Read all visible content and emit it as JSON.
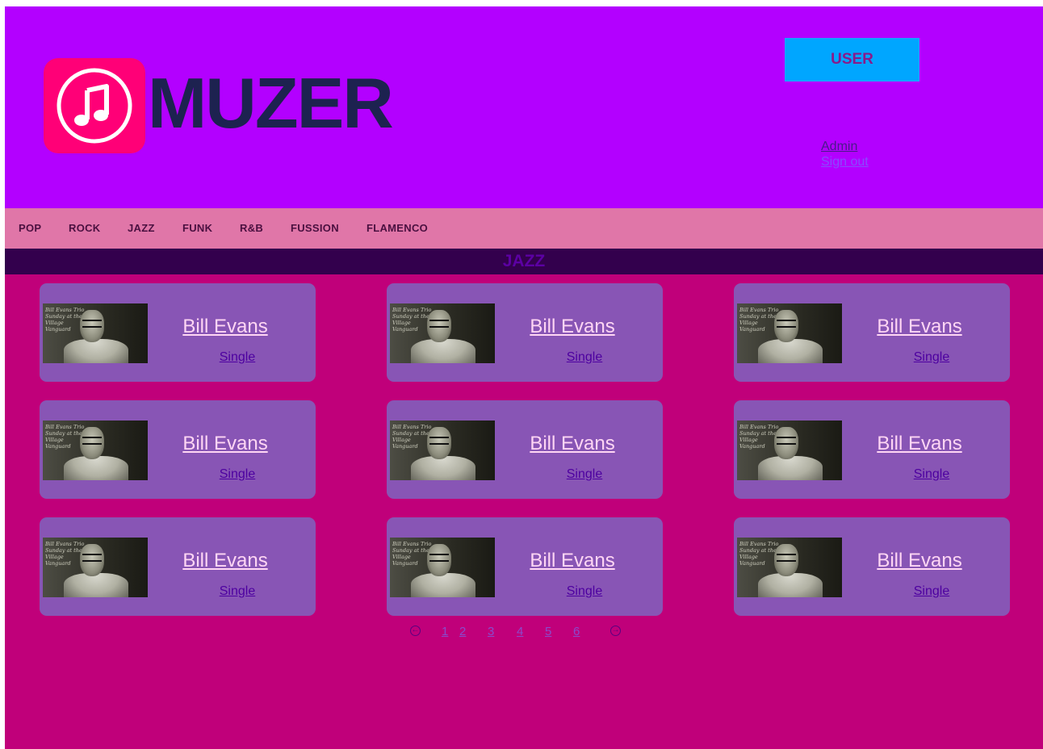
{
  "header": {
    "logo_text": "MUZER",
    "user_button": "USER",
    "admin_link": "Admin",
    "signout_link": "Sign out"
  },
  "nav": {
    "items": [
      "POP",
      "ROCK",
      "JAZZ",
      "FUNK",
      "R&B",
      "FUSSION",
      "FLAMENCO"
    ]
  },
  "section": {
    "title": "JAZZ"
  },
  "cards": [
    {
      "title": "Bill Evans",
      "subtitle": "Single",
      "cover_text": "Bill Evans Trio Sunday at the Village Vanguard"
    },
    {
      "title": "Bill Evans",
      "subtitle": "Single",
      "cover_text": "Bill Evans Trio Sunday at the Village Vanguard"
    },
    {
      "title": "Bill Evans",
      "subtitle": "Single",
      "cover_text": "Bill Evans Trio Sunday at the Village Vanguard"
    },
    {
      "title": "Bill Evans",
      "subtitle": "Single",
      "cover_text": "Bill Evans Trio Sunday at the Village Vanguard"
    },
    {
      "title": "Bill Evans",
      "subtitle": "Single",
      "cover_text": "Bill Evans Trio Sunday at the Village Vanguard"
    },
    {
      "title": "Bill Evans",
      "subtitle": "Single",
      "cover_text": "Bill Evans Trio Sunday at the Village Vanguard"
    },
    {
      "title": "Bill Evans",
      "subtitle": "Single",
      "cover_text": "Bill Evans Trio Sunday at the Village Vanguard"
    },
    {
      "title": "Bill Evans",
      "subtitle": "Single",
      "cover_text": "Bill Evans Trio Sunday at the Village Vanguard"
    },
    {
      "title": "Bill Evans",
      "subtitle": "Single",
      "cover_text": "Bill Evans Trio Sunday at the Village Vanguard"
    }
  ],
  "pagination": {
    "pages": [
      "1",
      "2",
      "3",
      "4",
      "5",
      "6"
    ],
    "prev_icon": "arrow-left-circle-icon",
    "next_icon": "arrow-right-circle-icon"
  },
  "colors": {
    "page_bg": "#c0007a",
    "header_bg": "#b300ff",
    "nav_bg": "#e076a8",
    "section_bar_bg": "#33004d",
    "card_bg": "#8855b5",
    "logo_badge": "#ff0077",
    "user_button_bg": "#00a6ff"
  }
}
